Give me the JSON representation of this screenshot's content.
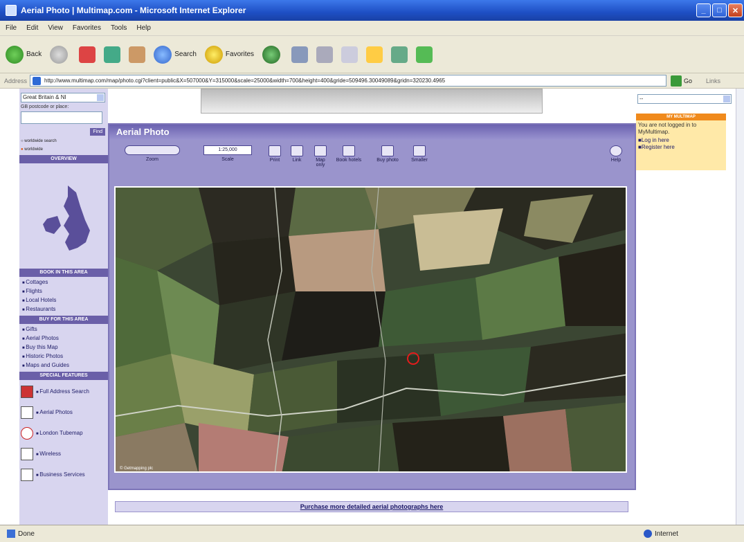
{
  "window": {
    "title": "Aerial Photo | Multimap.com - Microsoft Internet Explorer",
    "buttons": {
      "minimize": "_",
      "maximize": "□",
      "close": "✕"
    }
  },
  "menu": [
    "File",
    "Edit",
    "View",
    "Favorites",
    "Tools",
    "Help"
  ],
  "toolbar": {
    "back_label": "Back",
    "search_label": "Search",
    "favorites_label": "Favorites"
  },
  "address": {
    "label": "Address",
    "url": "http://www.multimap.com/map/photo.cgi?client=public&X=507000&Y=315000&scale=25000&width=700&height=400&gride=509496.30049089&gridn=320230.4965",
    "go_label": "Go",
    "links_label": "Links"
  },
  "sidebar": {
    "country_select": "Great Britain & NI",
    "search_label": "GB postcode or place:",
    "find_button": "Find",
    "radio_1": "worldwide search",
    "radio_2": "worldwide",
    "overview_header": "OVERVIEW",
    "book_header": "BOOK IN THIS AREA",
    "book_items": [
      "Cottages",
      "Flights",
      "Local Hotels",
      "Restaurants"
    ],
    "buy_header": "BUY FOR THIS AREA",
    "buy_items": [
      "Gifts",
      "Aerial Photos",
      "Buy this Map",
      "Historic Photos",
      "Maps and Guides"
    ],
    "special_header": "SPECIAL FEATURES",
    "special_items": [
      "Full Address Search",
      "Aerial Photos",
      "London Tubemap",
      "Wireless",
      "Business Services"
    ]
  },
  "main": {
    "panel_title": "Aerial Photo",
    "zoom_label": "Zoom",
    "scale_value": "1:25,000",
    "scale_label": "Scale",
    "controls": [
      "Print",
      "Link",
      "Map only",
      "Book hotels",
      "Buy photo",
      "Smaller"
    ],
    "help_label": "Help",
    "copyright": "© Getmapping plc",
    "purchase_link": "Purchase more detailed aerial photographs here"
  },
  "rightcol": {
    "select_value": "--",
    "header": "MY MULTIMAP",
    "text": "You are not logged in to MyMultimap.",
    "links": [
      "Log in here",
      "Register here"
    ]
  },
  "status": {
    "left": "Done",
    "right": "Internet"
  }
}
